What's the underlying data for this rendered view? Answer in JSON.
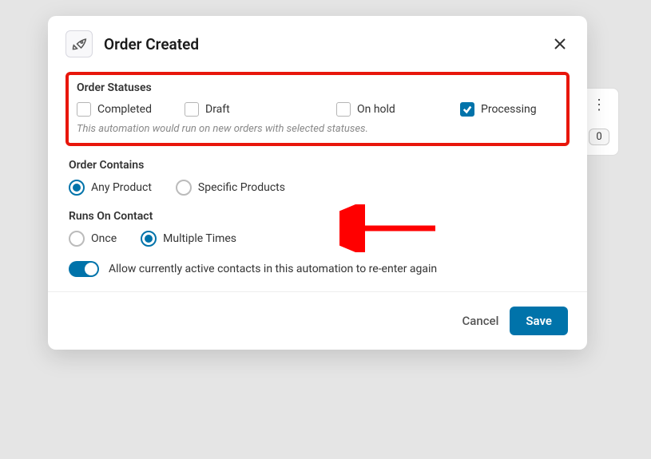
{
  "header": {
    "title": "Order Created"
  },
  "orderStatuses": {
    "label": "Order Statuses",
    "options": {
      "completed": "Completed",
      "draft": "Draft",
      "onhold": "On hold",
      "processing": "Processing"
    },
    "helper": "This automation would run on new orders with selected statuses."
  },
  "orderContains": {
    "label": "Order Contains",
    "options": {
      "any": "Any Product",
      "specific": "Specific Products"
    }
  },
  "runsOnContact": {
    "label": "Runs On Contact",
    "options": {
      "once": "Once",
      "multiple": "Multiple Times"
    }
  },
  "toggle": {
    "label": "Allow currently active contacts in this automation to re-enter again"
  },
  "footer": {
    "cancel": "Cancel",
    "save": "Save"
  },
  "backdrop": {
    "badge": "0"
  }
}
